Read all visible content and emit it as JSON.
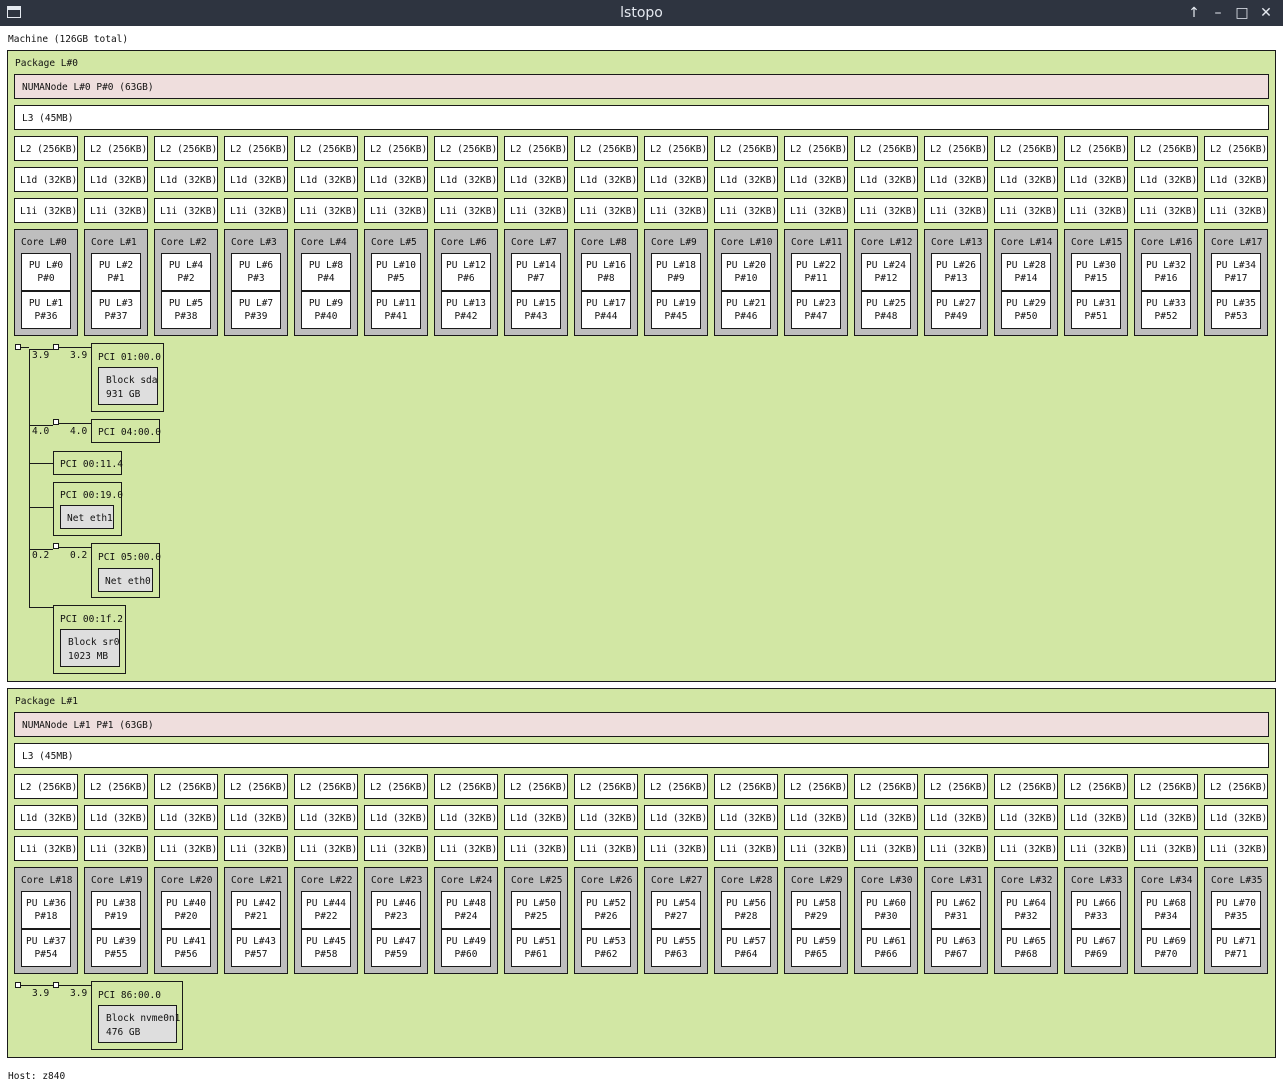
{
  "window": {
    "title": "lstopo"
  },
  "machine": {
    "label": "Machine (126GB total)"
  },
  "packages": [
    {
      "label": "Package L#0",
      "numa": "NUMANode L#0 P#0 (63GB)",
      "l3": "L3 (45MB)",
      "l2": "L2 (256KB)",
      "l1d": "L1d (32KB)",
      "l1i": "L1i (32KB)",
      "cores": [
        {
          "label": "Core L#0",
          "pus": [
            {
              "l": "PU L#0",
              "p": "P#0"
            },
            {
              "l": "PU L#1",
              "p": "P#36"
            }
          ]
        },
        {
          "label": "Core L#1",
          "pus": [
            {
              "l": "PU L#2",
              "p": "P#1"
            },
            {
              "l": "PU L#3",
              "p": "P#37"
            }
          ]
        },
        {
          "label": "Core L#2",
          "pus": [
            {
              "l": "PU L#4",
              "p": "P#2"
            },
            {
              "l": "PU L#5",
              "p": "P#38"
            }
          ]
        },
        {
          "label": "Core L#3",
          "pus": [
            {
              "l": "PU L#6",
              "p": "P#3"
            },
            {
              "l": "PU L#7",
              "p": "P#39"
            }
          ]
        },
        {
          "label": "Core L#4",
          "pus": [
            {
              "l": "PU L#8",
              "p": "P#4"
            },
            {
              "l": "PU L#9",
              "p": "P#40"
            }
          ]
        },
        {
          "label": "Core L#5",
          "pus": [
            {
              "l": "PU L#10",
              "p": "P#5"
            },
            {
              "l": "PU L#11",
              "p": "P#41"
            }
          ]
        },
        {
          "label": "Core L#6",
          "pus": [
            {
              "l": "PU L#12",
              "p": "P#6"
            },
            {
              "l": "PU L#13",
              "p": "P#42"
            }
          ]
        },
        {
          "label": "Core L#7",
          "pus": [
            {
              "l": "PU L#14",
              "p": "P#7"
            },
            {
              "l": "PU L#15",
              "p": "P#43"
            }
          ]
        },
        {
          "label": "Core L#8",
          "pus": [
            {
              "l": "PU L#16",
              "p": "P#8"
            },
            {
              "l": "PU L#17",
              "p": "P#44"
            }
          ]
        },
        {
          "label": "Core L#9",
          "pus": [
            {
              "l": "PU L#18",
              "p": "P#9"
            },
            {
              "l": "PU L#19",
              "p": "P#45"
            }
          ]
        },
        {
          "label": "Core L#10",
          "pus": [
            {
              "l": "PU L#20",
              "p": "P#10"
            },
            {
              "l": "PU L#21",
              "p": "P#46"
            }
          ]
        },
        {
          "label": "Core L#11",
          "pus": [
            {
              "l": "PU L#22",
              "p": "P#11"
            },
            {
              "l": "PU L#23",
              "p": "P#47"
            }
          ]
        },
        {
          "label": "Core L#12",
          "pus": [
            {
              "l": "PU L#24",
              "p": "P#12"
            },
            {
              "l": "PU L#25",
              "p": "P#48"
            }
          ]
        },
        {
          "label": "Core L#13",
          "pus": [
            {
              "l": "PU L#26",
              "p": "P#13"
            },
            {
              "l": "PU L#27",
              "p": "P#49"
            }
          ]
        },
        {
          "label": "Core L#14",
          "pus": [
            {
              "l": "PU L#28",
              "p": "P#14"
            },
            {
              "l": "PU L#29",
              "p": "P#50"
            }
          ]
        },
        {
          "label": "Core L#15",
          "pus": [
            {
              "l": "PU L#30",
              "p": "P#15"
            },
            {
              "l": "PU L#31",
              "p": "P#51"
            }
          ]
        },
        {
          "label": "Core L#16",
          "pus": [
            {
              "l": "PU L#32",
              "p": "P#16"
            },
            {
              "l": "PU L#33",
              "p": "P#52"
            }
          ]
        },
        {
          "label": "Core L#17",
          "pus": [
            {
              "l": "PU L#34",
              "p": "P#17"
            },
            {
              "l": "PU L#35",
              "p": "P#53"
            }
          ]
        }
      ],
      "io": {
        "bw_sda_left": "3.9",
        "bw_sda_right": "3.9",
        "pci_sda": "PCI 01:00.0",
        "sda_name": "Block sda",
        "sda_size": "931 GB",
        "bw_pci04_left": "4.0",
        "bw_pci04_right": "4.0",
        "pci04": "PCI 04:00.0",
        "pci_114": "PCI 00:11.4",
        "pci_eth1": "PCI 00:19.0",
        "eth1": "Net eth1",
        "bw_eth0_left": "0.2",
        "bw_eth0_right": "0.2",
        "pci_eth0": "PCI 05:00.0",
        "eth0": "Net eth0",
        "pci_sr0": "PCI 00:1f.2",
        "sr0_name": "Block sr0",
        "sr0_size": "1023 MB"
      }
    },
    {
      "label": "Package L#1",
      "numa": "NUMANode L#1 P#1 (63GB)",
      "l3": "L3 (45MB)",
      "l2": "L2 (256KB)",
      "l1d": "L1d (32KB)",
      "l1i": "L1i (32KB)",
      "cores": [
        {
          "label": "Core L#18",
          "pus": [
            {
              "l": "PU L#36",
              "p": "P#18"
            },
            {
              "l": "PU L#37",
              "p": "P#54"
            }
          ]
        },
        {
          "label": "Core L#19",
          "pus": [
            {
              "l": "PU L#38",
              "p": "P#19"
            },
            {
              "l": "PU L#39",
              "p": "P#55"
            }
          ]
        },
        {
          "label": "Core L#20",
          "pus": [
            {
              "l": "PU L#40",
              "p": "P#20"
            },
            {
              "l": "PU L#41",
              "p": "P#56"
            }
          ]
        },
        {
          "label": "Core L#21",
          "pus": [
            {
              "l": "PU L#42",
              "p": "P#21"
            },
            {
              "l": "PU L#43",
              "p": "P#57"
            }
          ]
        },
        {
          "label": "Core L#22",
          "pus": [
            {
              "l": "PU L#44",
              "p": "P#22"
            },
            {
              "l": "PU L#45",
              "p": "P#58"
            }
          ]
        },
        {
          "label": "Core L#23",
          "pus": [
            {
              "l": "PU L#46",
              "p": "P#23"
            },
            {
              "l": "PU L#47",
              "p": "P#59"
            }
          ]
        },
        {
          "label": "Core L#24",
          "pus": [
            {
              "l": "PU L#48",
              "p": "P#24"
            },
            {
              "l": "PU L#49",
              "p": "P#60"
            }
          ]
        },
        {
          "label": "Core L#25",
          "pus": [
            {
              "l": "PU L#50",
              "p": "P#25"
            },
            {
              "l": "PU L#51",
              "p": "P#61"
            }
          ]
        },
        {
          "label": "Core L#26",
          "pus": [
            {
              "l": "PU L#52",
              "p": "P#26"
            },
            {
              "l": "PU L#53",
              "p": "P#62"
            }
          ]
        },
        {
          "label": "Core L#27",
          "pus": [
            {
              "l": "PU L#54",
              "p": "P#27"
            },
            {
              "l": "PU L#55",
              "p": "P#63"
            }
          ]
        },
        {
          "label": "Core L#28",
          "pus": [
            {
              "l": "PU L#56",
              "p": "P#28"
            },
            {
              "l": "PU L#57",
              "p": "P#64"
            }
          ]
        },
        {
          "label": "Core L#29",
          "pus": [
            {
              "l": "PU L#58",
              "p": "P#29"
            },
            {
              "l": "PU L#59",
              "p": "P#65"
            }
          ]
        },
        {
          "label": "Core L#30",
          "pus": [
            {
              "l": "PU L#60",
              "p": "P#30"
            },
            {
              "l": "PU L#61",
              "p": "P#66"
            }
          ]
        },
        {
          "label": "Core L#31",
          "pus": [
            {
              "l": "PU L#62",
              "p": "P#31"
            },
            {
              "l": "PU L#63",
              "p": "P#67"
            }
          ]
        },
        {
          "label": "Core L#32",
          "pus": [
            {
              "l": "PU L#64",
              "p": "P#32"
            },
            {
              "l": "PU L#65",
              "p": "P#68"
            }
          ]
        },
        {
          "label": "Core L#33",
          "pus": [
            {
              "l": "PU L#66",
              "p": "P#33"
            },
            {
              "l": "PU L#67",
              "p": "P#69"
            }
          ]
        },
        {
          "label": "Core L#34",
          "pus": [
            {
              "l": "PU L#68",
              "p": "P#34"
            },
            {
              "l": "PU L#69",
              "p": "P#70"
            }
          ]
        },
        {
          "label": "Core L#35",
          "pus": [
            {
              "l": "PU L#70",
              "p": "P#35"
            },
            {
              "l": "PU L#71",
              "p": "P#71"
            }
          ]
        }
      ],
      "io": {
        "bw_nvme_left": "3.9",
        "bw_nvme_right": "3.9",
        "pci_nvme": "PCI 86:00.0",
        "nvme_name": "Block nvme0n1",
        "nvme_size": "476 GB"
      }
    }
  ],
  "footer": {
    "host": "Host: z840"
  }
}
